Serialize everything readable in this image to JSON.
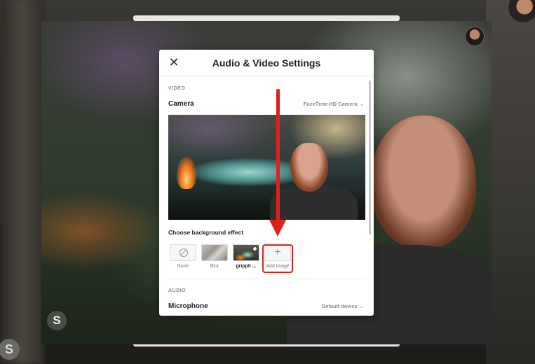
{
  "dialog": {
    "title": "Audio & Video Settings",
    "close_icon": "close-icon"
  },
  "video_section": {
    "heading": "VIDEO",
    "camera_label": "Camera",
    "camera_value": "FaceTime HD Camera"
  },
  "background_effects": {
    "heading": "Choose background effect",
    "items": [
      {
        "label": "None",
        "icon": "none-icon"
      },
      {
        "label": "Blur",
        "icon": "blur-thumbnail"
      },
      {
        "label": "grippli ...",
        "icon": "image-thumbnail",
        "selected": true
      },
      {
        "label": "Add image",
        "icon": "plus-icon"
      }
    ]
  },
  "audio_section": {
    "heading": "AUDIO",
    "microphone_label": "Microphone",
    "microphone_value": "Default device"
  },
  "annotation": {
    "arrow_color": "#e0211b",
    "highlight_target": "Add image"
  },
  "app_badge": "S"
}
